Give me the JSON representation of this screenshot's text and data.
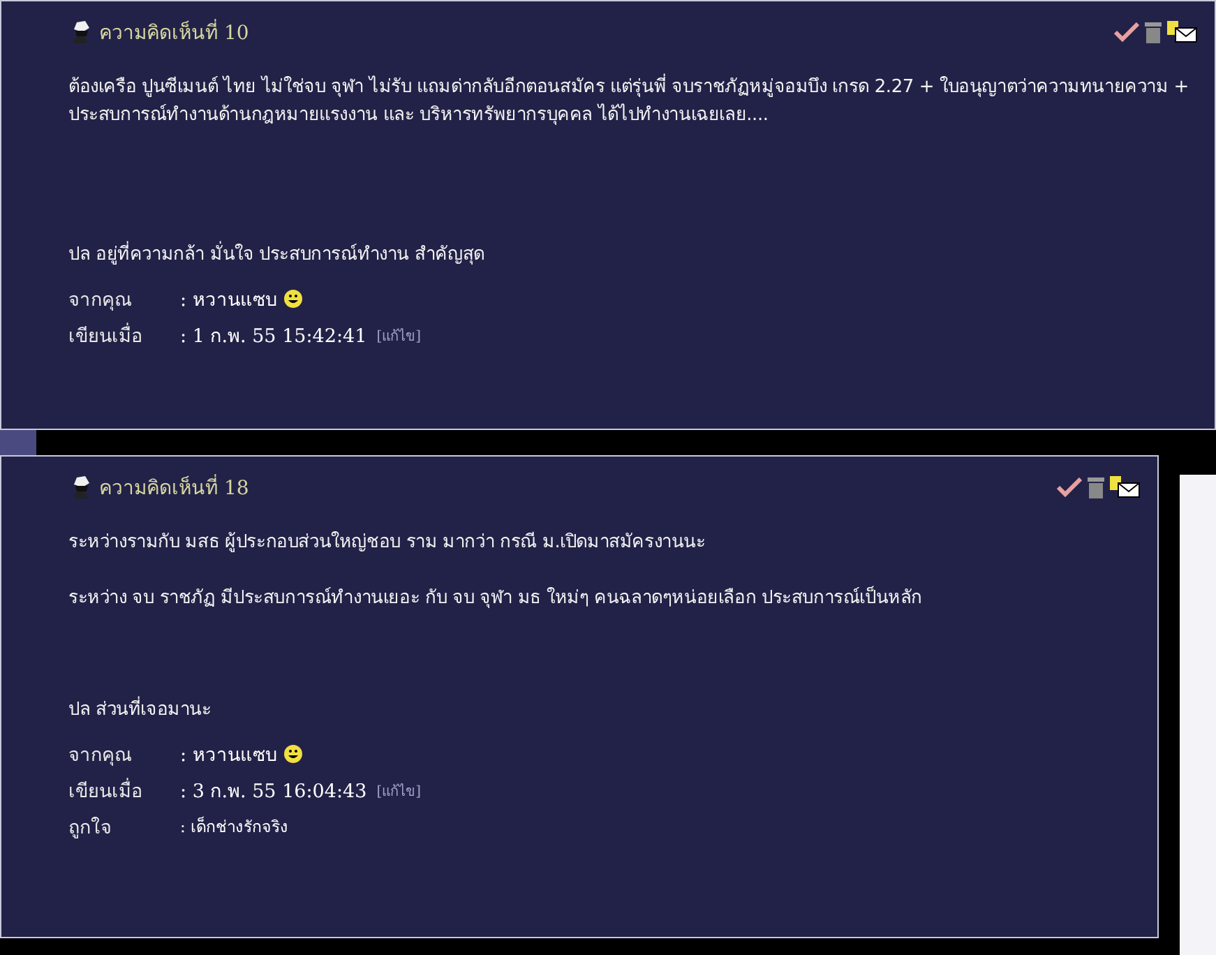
{
  "comments": [
    {
      "title": "ความคิดเห็นที่ 10",
      "body": [
        {
          "kind": "text",
          "text": "ต้องเครือ ปูนซีเมนต์ ไทย ไม่ใช่จบ จุฬา ไม่รับ แถมด่ากลับอีกตอนสมัคร แต่รุ่นพี่ จบราชภัฏหมู่จอมบึง เกรด 2.27  + ใบอนุญาตว่าความทนายความ + ประสบการณ์ทำงานด้านกฎหมายแรงงาน และ บริหารทรัพยากรบุคคล  ได้ไปทำงานเฉยเลย...."
        },
        {
          "kind": "blank"
        },
        {
          "kind": "blank"
        },
        {
          "kind": "blank"
        },
        {
          "kind": "blank"
        },
        {
          "kind": "text",
          "text": "ปล อยู่ที่ความกล้า มั่นใจ ประสบการณ์ทำงาน สำคัญสุด"
        }
      ],
      "meta": [
        {
          "kind": "author",
          "label": "จากคุณ",
          "value": ": หวานแซบ"
        },
        {
          "kind": "date",
          "label": "เขียนเมื่อ",
          "value": ": 1 ก.พ. 55 15:42:41",
          "link": "[แก้ไข]"
        }
      ]
    },
    {
      "title": "ความคิดเห็นที่ 18",
      "body": [
        {
          "kind": "text",
          "text": "ระหว่างรามกับ มสธ  ผู้ประกอบส่วนใหญ่ชอบ ราม มากว่า กรณี ม.เปิดมาสมัครงานนะ"
        },
        {
          "kind": "blank"
        },
        {
          "kind": "text",
          "text": "ระหว่าง จบ ราชภัฏ มีประสบการณ์ทำงานเยอะ   กับ จบ จุฬา มธ ใหม่ๆ  คนฉลาดๆหน่อยเลือก ประสบการณ์เป็นหลัก"
        },
        {
          "kind": "blank"
        },
        {
          "kind": "blank"
        },
        {
          "kind": "blank"
        },
        {
          "kind": "text",
          "text": "ปล  ส่วนที่เจอมานะ"
        }
      ],
      "meta": [
        {
          "kind": "author",
          "label": "จากคุณ",
          "value": ": หวานแซบ"
        },
        {
          "kind": "date",
          "label": "เขียนเมื่อ",
          "value": ": 3 ก.พ. 55 16:04:43",
          "link": "[แก้ไข]"
        },
        {
          "kind": "like",
          "label": "ถูกใจ",
          "value": ": เด็กช่างรักจริง"
        }
      ]
    }
  ]
}
